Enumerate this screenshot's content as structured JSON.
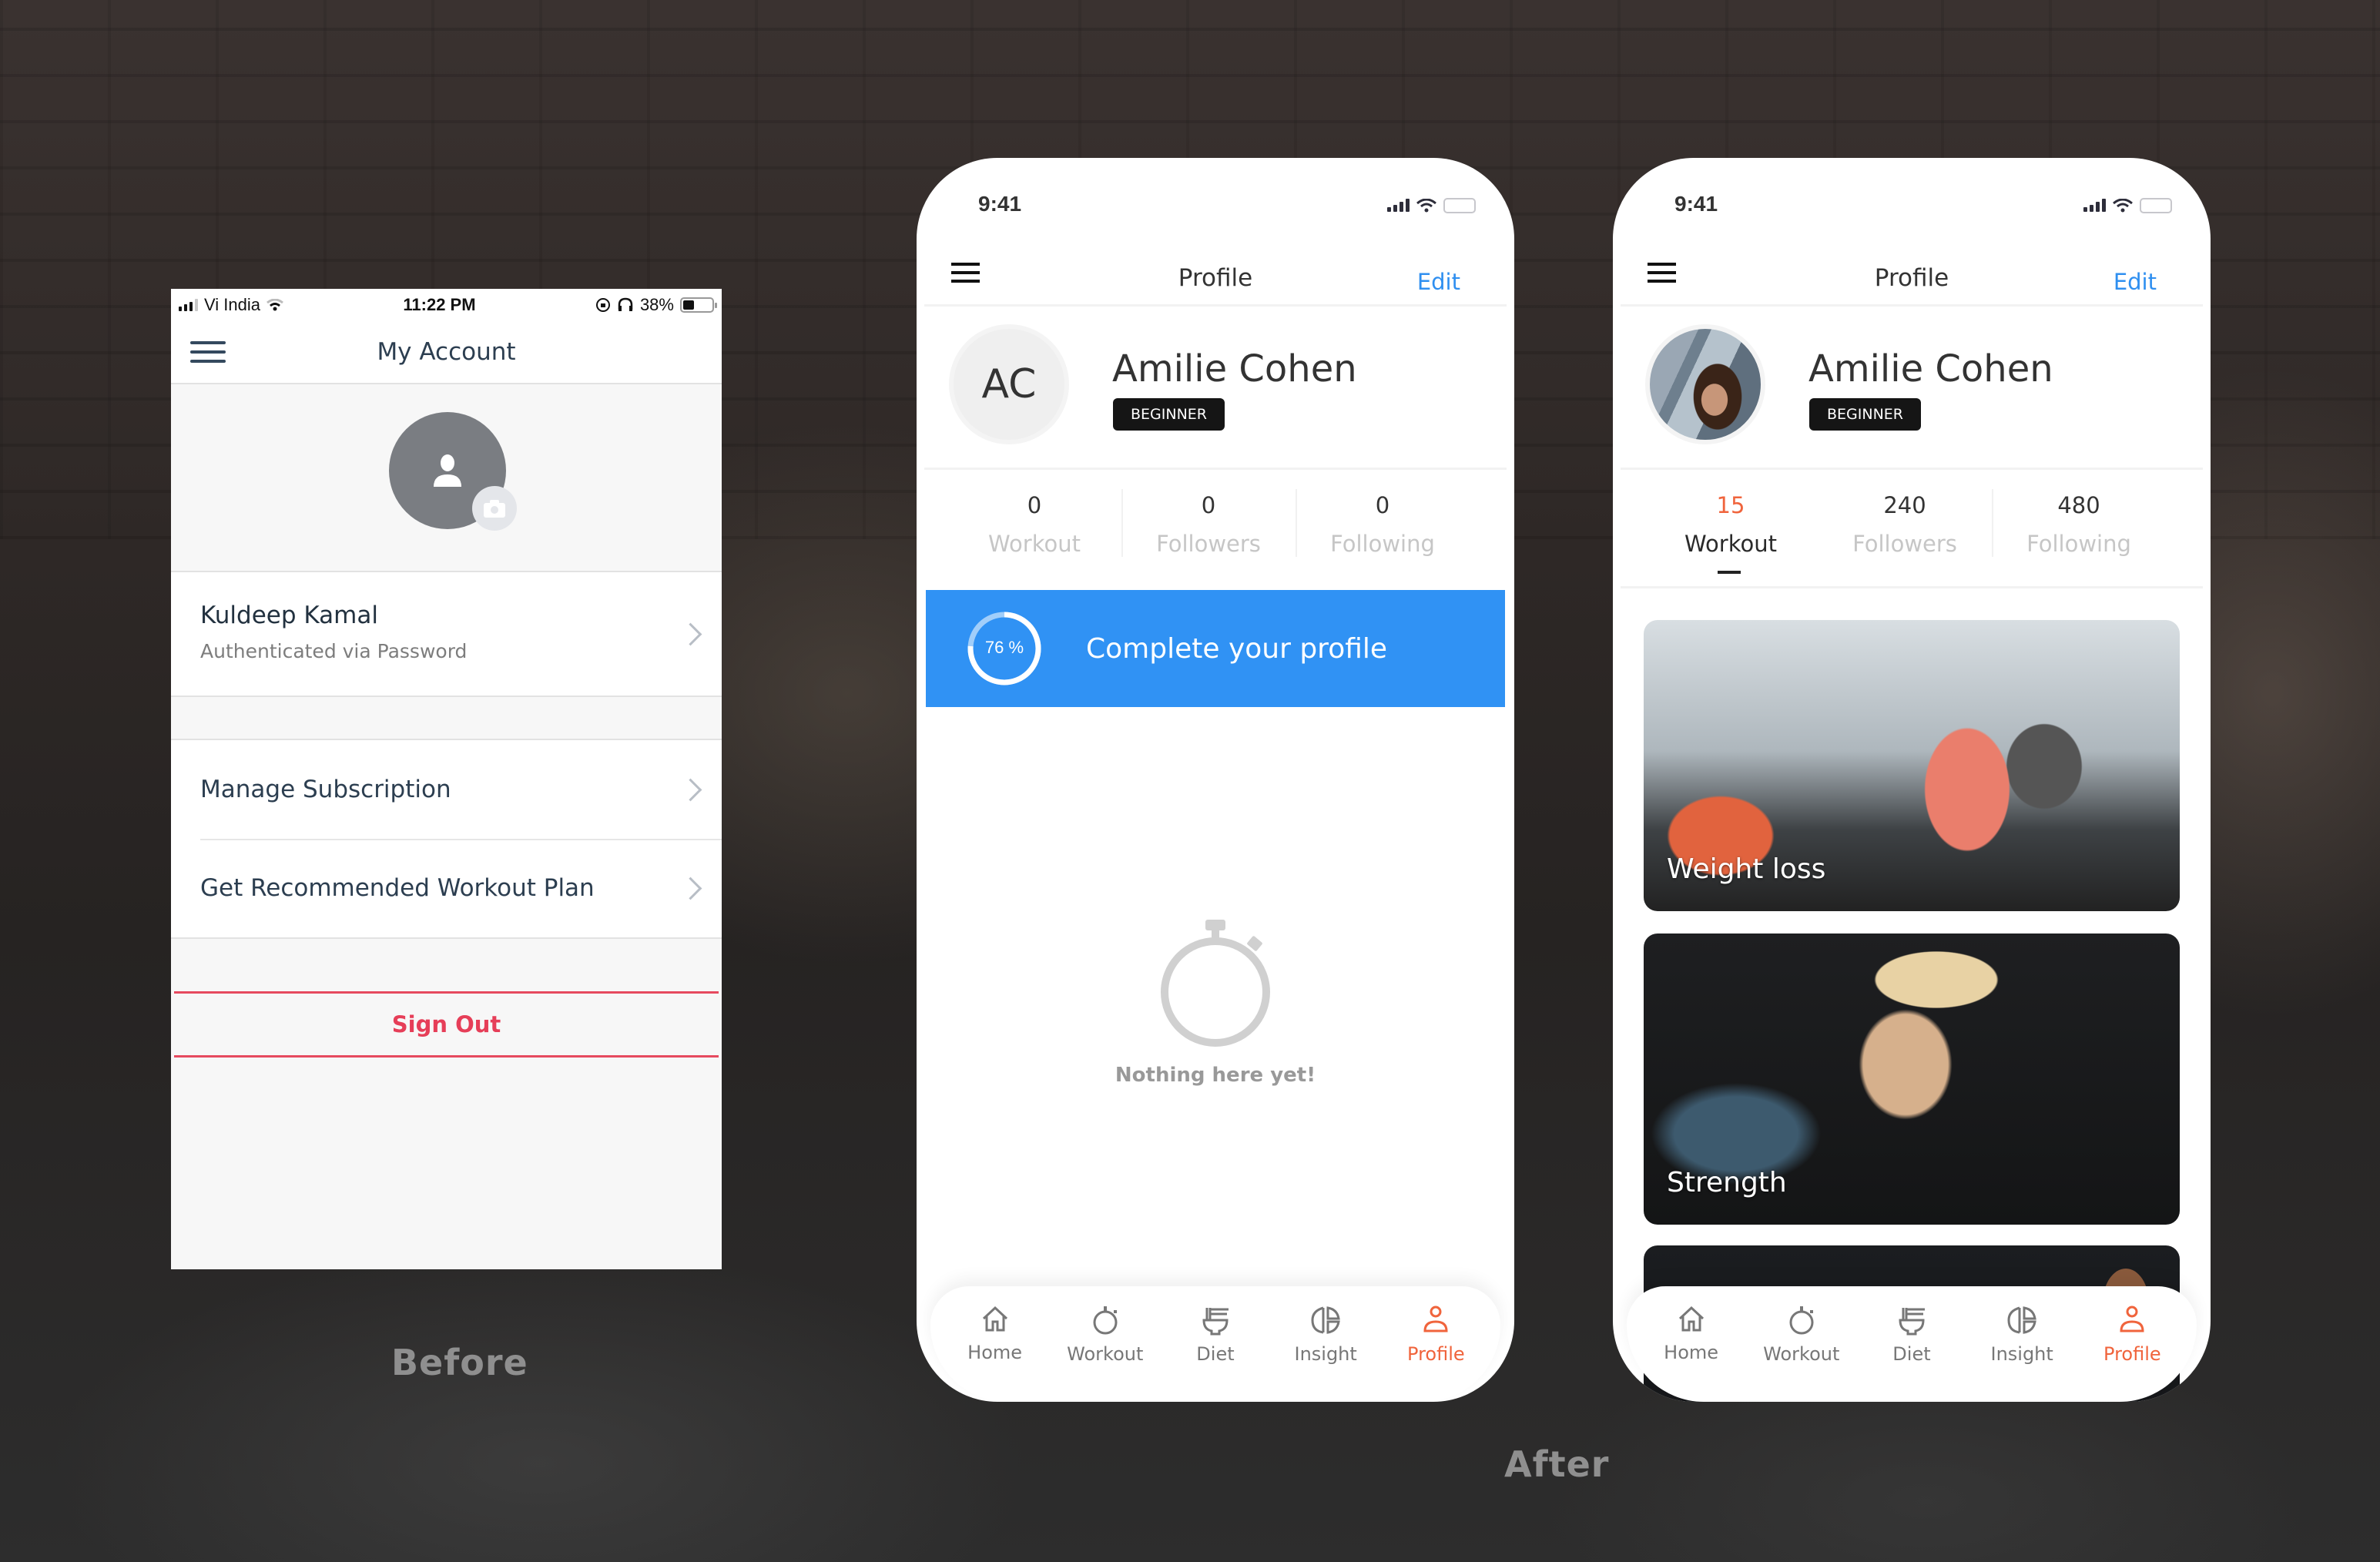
{
  "captions": {
    "before": "Before",
    "after": "After"
  },
  "before": {
    "status_bar": {
      "carrier": "Vi India",
      "time": "11:22 PM",
      "battery": "38%",
      "battery_level": 0.38
    },
    "nav": {
      "title": "My Account"
    },
    "user": {
      "name": "Kuldeep Kamal",
      "subtitle": "Authenticated via Password"
    },
    "menu": [
      {
        "label": "Manage Subscription"
      },
      {
        "label": "Get Recommended Workout Plan"
      }
    ],
    "sign_out": "Sign Out",
    "colors": {
      "accent_red": "#e63e58",
      "title": "#2c3e50",
      "avatar_bg": "#7a7d82"
    }
  },
  "after_empty": {
    "status_bar": {
      "time": "9:41"
    },
    "nav": {
      "title": "Profile",
      "edit": "Edit"
    },
    "profile": {
      "initials": "AC",
      "name": "Amilie Cohen",
      "level": "BEGINNER"
    },
    "stats": [
      {
        "value": "0",
        "label": "Workout"
      },
      {
        "value": "0",
        "label": "Followers"
      },
      {
        "value": "0",
        "label": "Following"
      }
    ],
    "cta": {
      "percent_label": "76 %",
      "percent": 76,
      "text": "Complete your profile"
    },
    "empty_state": {
      "message": "Nothing here yet!"
    },
    "tabs": [
      {
        "label": "Home",
        "icon": "home-icon"
      },
      {
        "label": "Workout",
        "icon": "stopwatch-icon"
      },
      {
        "label": "Diet",
        "icon": "bowl-icon"
      },
      {
        "label": "Insight",
        "icon": "insight-icon"
      },
      {
        "label": "Profile",
        "icon": "person-icon",
        "active": true
      }
    ]
  },
  "after_filled": {
    "status_bar": {
      "time": "9:41"
    },
    "nav": {
      "title": "Profile",
      "edit": "Edit"
    },
    "profile": {
      "name": "Amilie Cohen",
      "level": "BEGINNER"
    },
    "stats": [
      {
        "value": "15",
        "label": "Workout",
        "active": true
      },
      {
        "value": "240",
        "label": "Followers"
      },
      {
        "value": "480",
        "label": "Following"
      }
    ],
    "cards": [
      {
        "label": "Weight loss"
      },
      {
        "label": "Strength"
      },
      {
        "label": ""
      }
    ],
    "tabs": [
      {
        "label": "Home",
        "icon": "home-icon"
      },
      {
        "label": "Workout",
        "icon": "stopwatch-icon"
      },
      {
        "label": "Diet",
        "icon": "bowl-icon"
      },
      {
        "label": "Insight",
        "icon": "insight-icon"
      },
      {
        "label": "Profile",
        "icon": "person-icon",
        "active": true
      }
    ]
  },
  "colors": {
    "brand_orange": "#f0643c",
    "link_blue": "#2f8ff0",
    "cta_blue": "#3092f4",
    "badge_black": "#151515"
  }
}
